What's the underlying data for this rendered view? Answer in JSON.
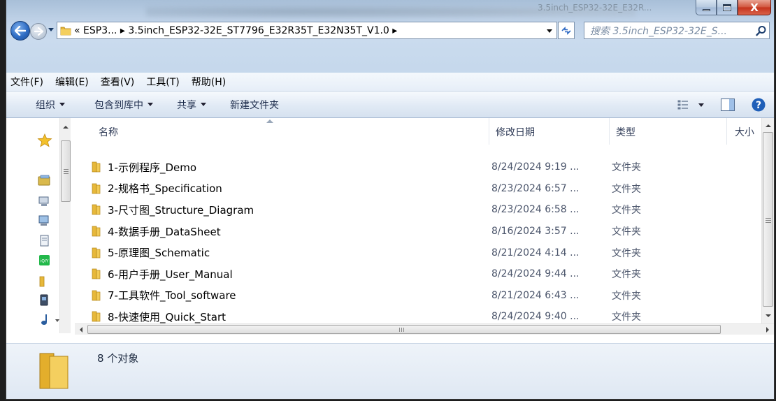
{
  "window": {
    "title_ghost": "3.5inch_ESP32-32E_E32R...",
    "close_label": "X"
  },
  "address": {
    "path": "« ESP3... ▸ 3.5inch_ESP32-32E_ST7796_E32R35T_E32N35T_V1.0 ▸"
  },
  "search": {
    "placeholder": "搜索 3.5inch_ESP32-32E_S..."
  },
  "menu": {
    "file": "文件(F)",
    "edit": "编辑(E)",
    "view": "查看(V)",
    "tools": "工具(T)",
    "help": "帮助(H)"
  },
  "toolbar": {
    "organize": "组织",
    "include_library": "包含到库中",
    "share": "共享",
    "new_folder": "新建文件夹"
  },
  "columns": {
    "name": "名称",
    "modified": "修改日期",
    "type": "类型",
    "size": "大小"
  },
  "files": [
    {
      "name": "1-示例程序_Demo",
      "modified": "8/24/2024 9:19 ...",
      "type": "文件夹"
    },
    {
      "name": "2-规格书_Specification",
      "modified": "8/23/2024 6:57 ...",
      "type": "文件夹"
    },
    {
      "name": "3-尺寸图_Structure_Diagram",
      "modified": "8/23/2024 6:58 ...",
      "type": "文件夹"
    },
    {
      "name": "4-数据手册_DataSheet",
      "modified": "8/16/2024 3:57 ...",
      "type": "文件夹"
    },
    {
      "name": "5-原理图_Schematic",
      "modified": "8/21/2024 4:14 ...",
      "type": "文件夹"
    },
    {
      "name": "6-用户手册_User_Manual",
      "modified": "8/24/2024 9:44 ...",
      "type": "文件夹"
    },
    {
      "name": "7-工具软件_Tool_software",
      "modified": "8/21/2024 6:43 ...",
      "type": "文件夹"
    },
    {
      "name": "8-快速使用_Quick_Start",
      "modified": "8/24/2024 9:40 ...",
      "type": "文件夹"
    }
  ],
  "nav_icons": [
    "favorites-star-icon",
    "desktop-icon",
    "network-icon",
    "computer-icon",
    "document-icon",
    "iqiyi-icon",
    "folder-icon",
    "media-player-icon",
    "music-icon"
  ],
  "status": {
    "count": "8 个对象"
  },
  "colors": {
    "folder": "#e7b83a",
    "accent": "#2f6dc4",
    "close": "#c4321b"
  }
}
